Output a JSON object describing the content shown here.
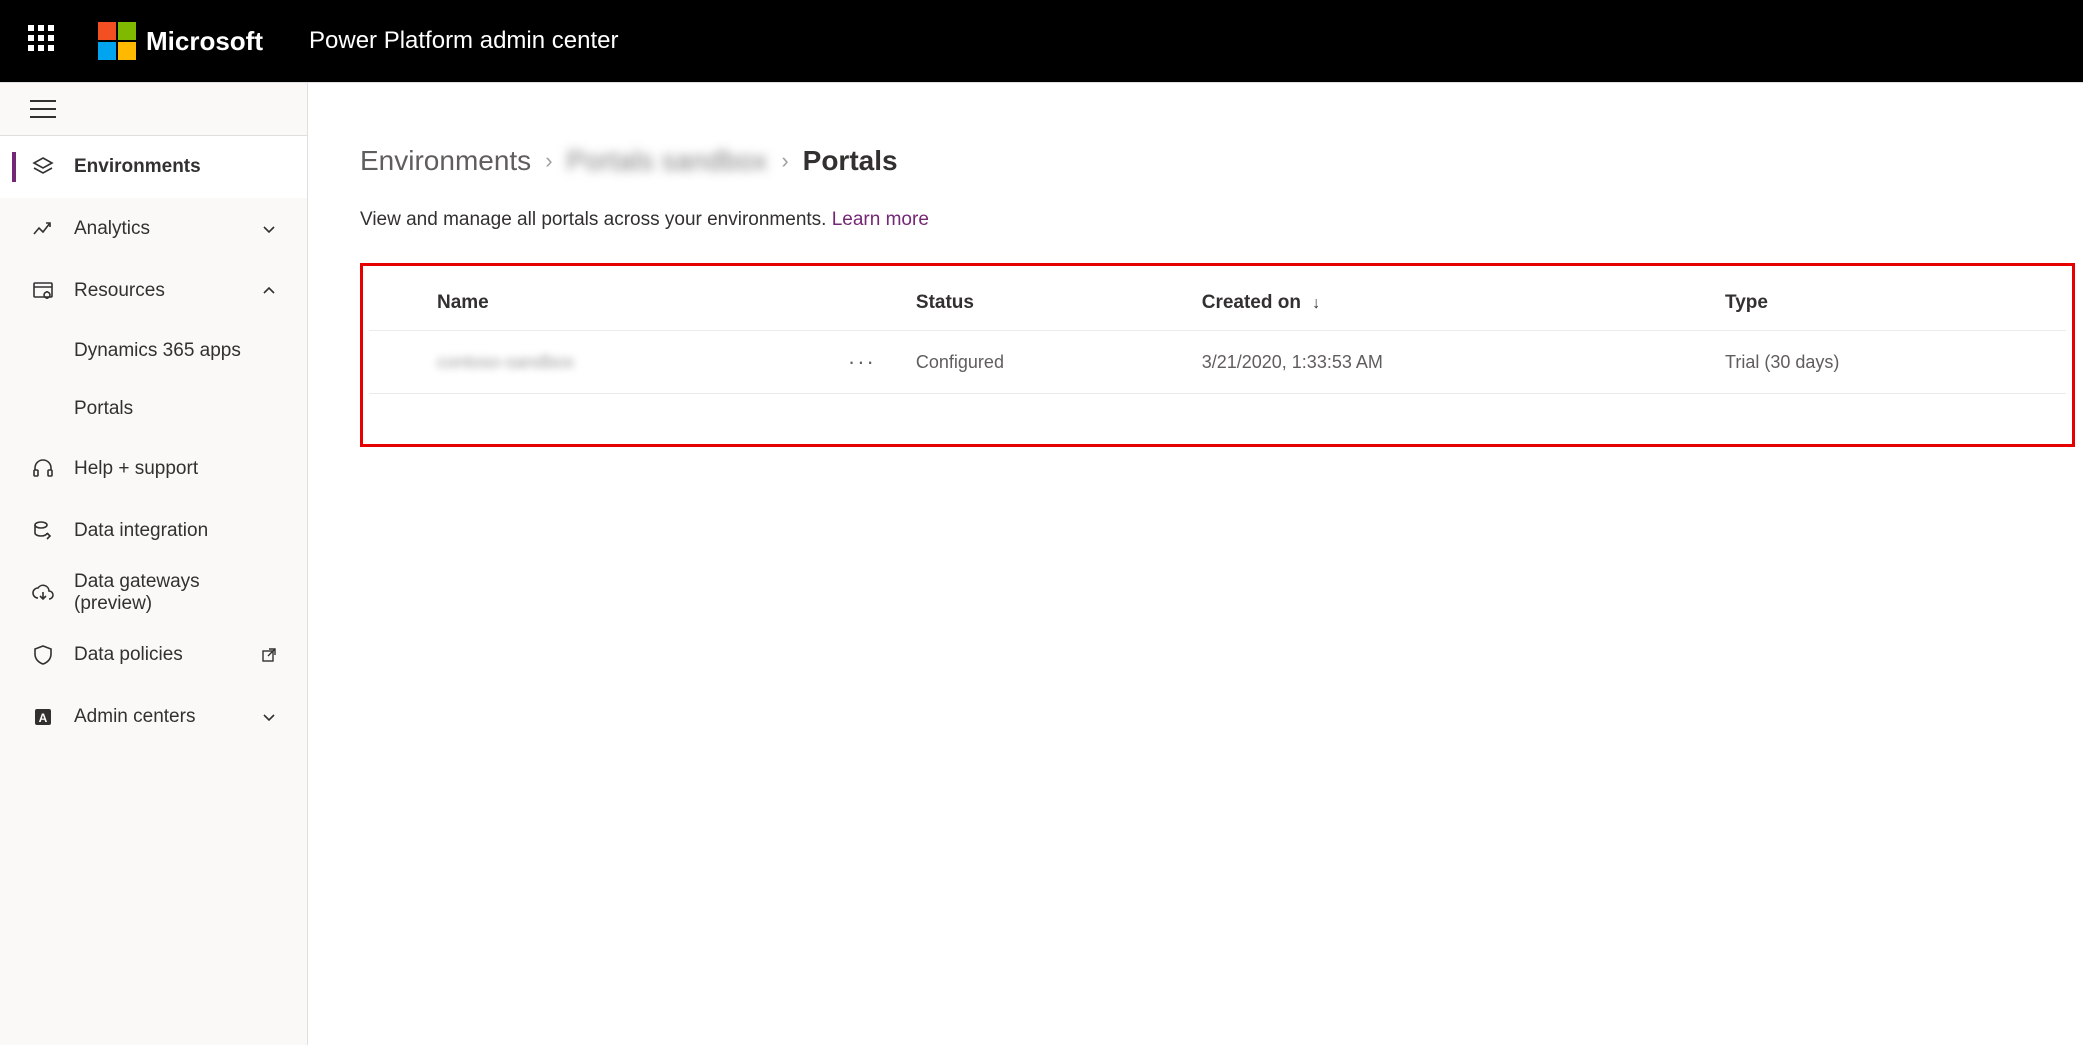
{
  "header": {
    "brand": "Microsoft",
    "app_title": "Power Platform admin center"
  },
  "sidebar": {
    "items": [
      {
        "label": "Environments",
        "icon": "layers-icon",
        "active": true
      },
      {
        "label": "Analytics",
        "icon": "chart-line-icon",
        "expandable": true,
        "expanded": false
      },
      {
        "label": "Resources",
        "icon": "window-gear-icon",
        "expandable": true,
        "expanded": true,
        "children": [
          {
            "label": "Dynamics 365 apps"
          },
          {
            "label": "Portals"
          }
        ]
      },
      {
        "label": "Help + support",
        "icon": "headset-icon"
      },
      {
        "label": "Data integration",
        "icon": "database-arrow-icon"
      },
      {
        "label": "Data gateways (preview)",
        "icon": "cloud-arrow-icon"
      },
      {
        "label": "Data policies",
        "icon": "shield-icon",
        "external": true
      },
      {
        "label": "Admin centers",
        "icon": "admin-icon",
        "expandable": true,
        "expanded": false
      }
    ]
  },
  "breadcrumb": {
    "root": "Environments",
    "env_name": "Portals sandbox",
    "current": "Portals"
  },
  "intro": {
    "text": "View and manage all portals across your environments. ",
    "link": "Learn more"
  },
  "table": {
    "columns": {
      "name": "Name",
      "status": "Status",
      "created_on": "Created on",
      "type": "Type"
    },
    "sort_column": "created_on",
    "rows": [
      {
        "name": "contoso-sandbox",
        "status": "Configured",
        "created_on": "3/21/2020, 1:33:53 AM",
        "type": "Trial (30 days)"
      }
    ]
  }
}
